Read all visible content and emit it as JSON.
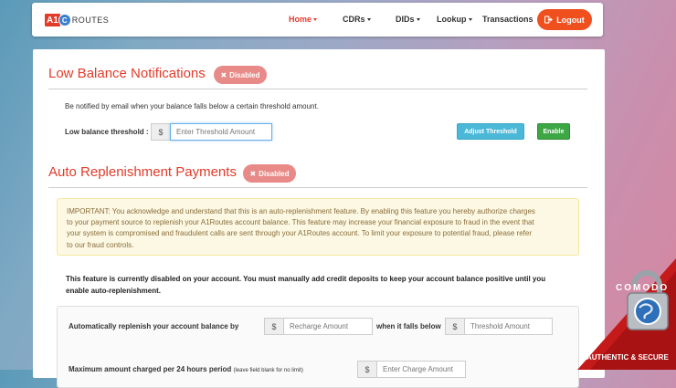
{
  "nav": {
    "logo_box": "A1",
    "logo_circle": "C",
    "logo_text": "ROUTES",
    "items": [
      {
        "label": "Home",
        "dropdown": true,
        "active": true
      },
      {
        "label": "CDRs",
        "dropdown": true,
        "active": false
      },
      {
        "label": "DIDs",
        "dropdown": true,
        "active": false
      },
      {
        "label": "Lookup",
        "dropdown": true,
        "active": false
      },
      {
        "label": "Transactions",
        "dropdown": false,
        "active": false
      }
    ],
    "logout_label": "Logout"
  },
  "low_balance": {
    "title": "Low Balance Notifications",
    "badge": "Disabled",
    "description": "Be notified by email when your balance falls below a certain threshold amount.",
    "threshold_label": "Low balance threshold :",
    "currency": "$",
    "threshold_placeholder": "Enter Threshold Amount",
    "adjust_button": "Adjust Threshold",
    "enable_button": "Enable"
  },
  "auto_replenish": {
    "title": "Auto Replenishment Payments",
    "badge": "Disabled",
    "warning_lines": [
      "IMPORTANT: You acknowledge and understand that this is an auto-replenishment feature. By enabling this feature you hereby authorize charges",
      "to your payment source to replenish your A1Routes account balance. This feature may increase your financial exposure to fraud in the event that",
      "your system is compromised and fraudulent calls are sent through your A1Routes account. To limit your exposure to potential fraud, please refer",
      "to our fraud controls."
    ],
    "note_lines": [
      "This feature is currently disabled on your account. You must manually add credit deposits to keep your account balance positive until you",
      "enable auto-replenishment."
    ],
    "replenish_label": "Automatically replenish your account balance by",
    "currency": "$",
    "recharge_placeholder": "Recharge Amount",
    "falls_label": "when it falls below",
    "threshold_placeholder": "Threshold Amount",
    "max_label": "Maximum amount charged per 24 hours period",
    "max_hint": "(leave field blank for no limit)",
    "max_placeholder": "Enter Charge Amount"
  },
  "comodo": {
    "brand": "COMODO",
    "tagline": "AUTHENTIC & SECURE"
  },
  "colors": {
    "accent": "#e23b2a",
    "logout": "#f0501e",
    "badge": "#e88a87",
    "info": "#4bb8d8",
    "success": "#3ea745"
  }
}
